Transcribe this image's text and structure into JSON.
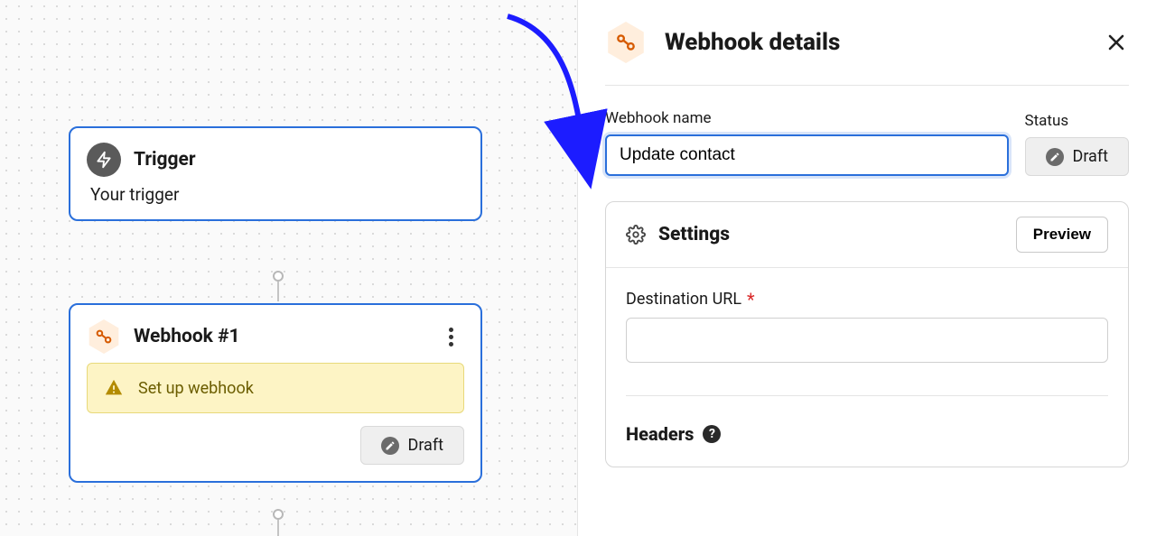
{
  "canvas": {
    "trigger": {
      "title": "Trigger",
      "body": "Your trigger"
    },
    "webhook": {
      "title": "Webhook #1",
      "alert": "Set up webhook",
      "status": "Draft"
    }
  },
  "panel": {
    "title": "Webhook details",
    "name_label": "Webhook name",
    "name_value": "Update contact",
    "status_label": "Status",
    "status_value": "Draft",
    "settings_title": "Settings",
    "preview_label": "Preview",
    "destination_label": "Destination URL",
    "destination_value": "",
    "headers_title": "Headers"
  }
}
